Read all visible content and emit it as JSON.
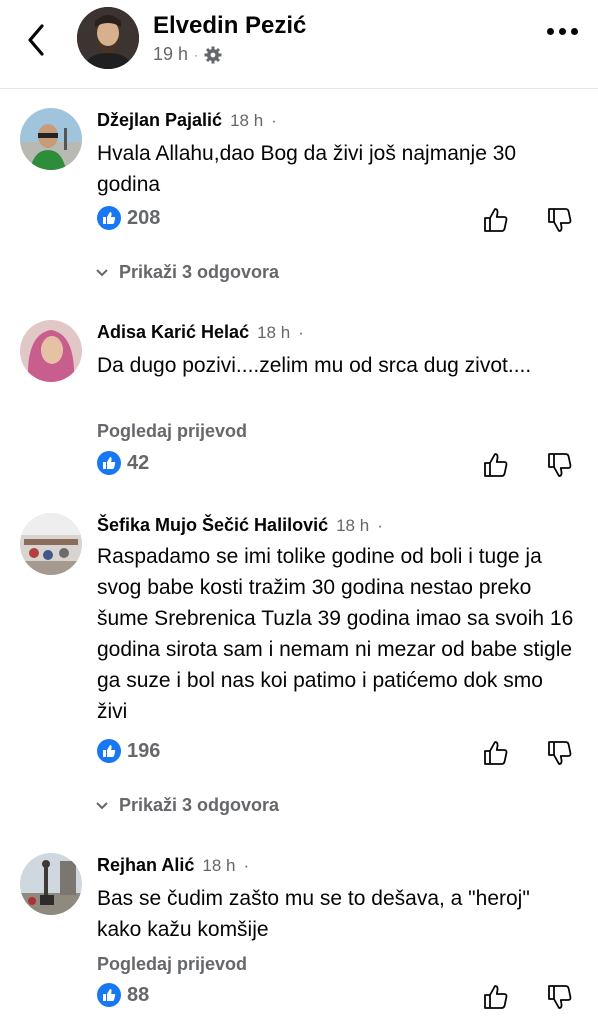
{
  "header": {
    "name": "Elvedin Pezić",
    "time": "19 h",
    "separator": "·"
  },
  "comments": [
    {
      "author": "Džejlan Pajalić",
      "time": "18 h",
      "text": "Hvala Allahu,dao Bog da živi još najmanje 30 godina",
      "likes": "208",
      "replies": "Prikaži 3 odgovora"
    },
    {
      "author": "Adisa Karić Helać",
      "time": "18 h",
      "text": "Da dugo pozivi....zelim mu od srca  dug zivot....",
      "translate": "Pogledaj prijevod",
      "likes": "42"
    },
    {
      "author": "Šefika Mujo Šečić Halilović",
      "time": "18 h",
      "text": "Raspadamo se imi tolike godine od boli i tuge ja svog babe kosti tražim 30 godina nestao preko šume Srebrenica Tuzla 39 godina imao sa svoih 16 godina sirota sam i nemam ni mezar od babe stigle ga suze i bol nas koi patimo i patićemo dok smo živi",
      "likes": "196",
      "replies": "Prikaži 3 odgovora"
    },
    {
      "author": "Rejhan Alić",
      "time": "18 h",
      "text": "Bas se čudim zašto mu se to dešava, a \"heroj\" kako kažu  komšije",
      "translate": "Pogledaj prijevod",
      "likes": "88"
    }
  ],
  "colors": {
    "accent": "#1877f2",
    "secondary_text": "#65676b",
    "primary_text": "#050505",
    "divider": "#e4e6eb"
  },
  "icons": [
    "chevron-left-icon",
    "gear-icon",
    "more-icon",
    "like-icon",
    "thumbs-up-icon",
    "thumbs-down-icon",
    "chevron-down-icon"
  ]
}
